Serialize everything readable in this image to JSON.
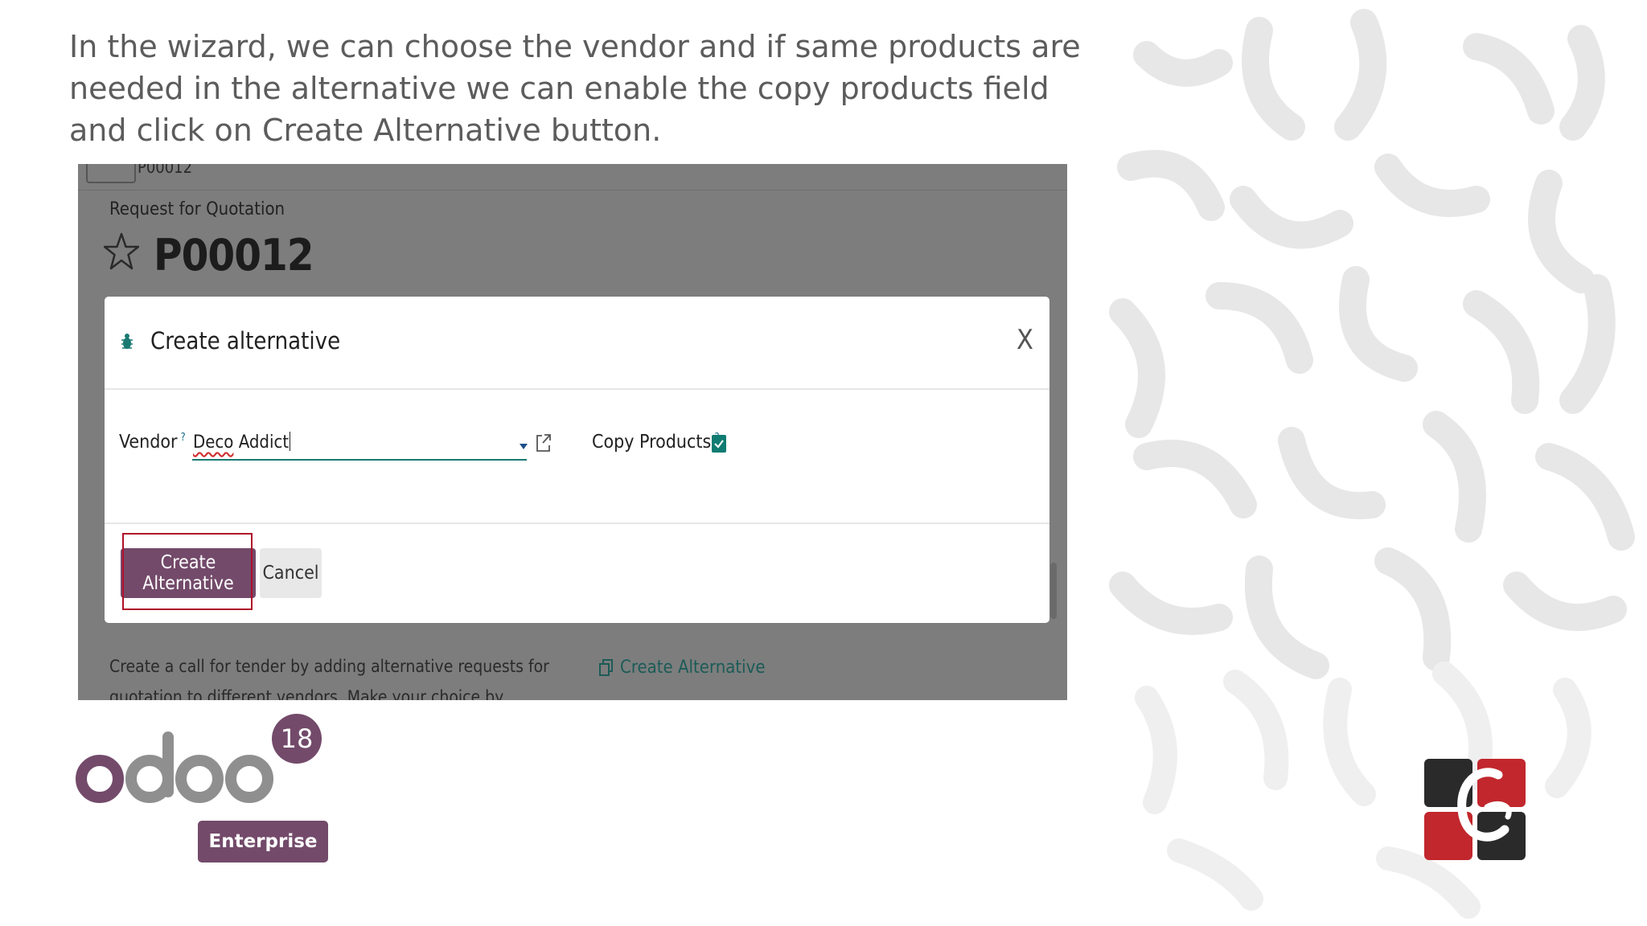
{
  "caption": "In the wizard, we can choose the vendor and if same products are needed in the alternative we can enable the copy products field and click on Create Alternative button.",
  "screenshot": {
    "top_ref": "P00012",
    "page_label": "Request for Quotation",
    "rfq_number": "P00012",
    "bottom_text": "Create a call for tender by adding alternative requests for quotation to different vendors. Make your choice by selecting the best combination of",
    "bottom_link": "Create Alternative"
  },
  "modal": {
    "title": "Create alternative",
    "close_label": "X",
    "vendor_label": "Vendor",
    "vendor_help": "?",
    "vendor_value": "Deco Addict",
    "vendor_value_first": "Deco",
    "vendor_value_rest": " Addict",
    "copy_products_label": "Copy Products",
    "copy_products_help": "?",
    "copy_products_checked": true,
    "create_button": "Create Alternative",
    "cancel_button": "Cancel"
  },
  "branding": {
    "odoo_version": "18",
    "edition": "Enterprise",
    "accent_color": "#734a6a"
  }
}
